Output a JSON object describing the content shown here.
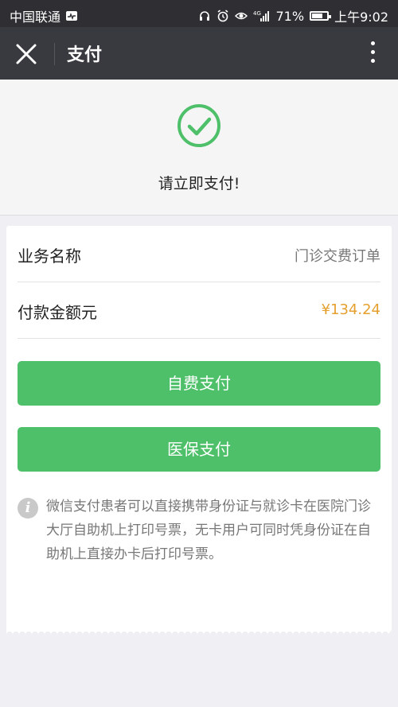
{
  "status_bar": {
    "carrier": "中国联通",
    "battery": "71%",
    "time": "上午9:02"
  },
  "nav": {
    "title": "支付"
  },
  "hero": {
    "message": "请立即支付!"
  },
  "order": {
    "business_label": "业务名称",
    "business_value": "门诊交费订单",
    "amount_label": "付款金额元",
    "amount_value": "¥134.24"
  },
  "buttons": {
    "self_pay": "自费支付",
    "insurance_pay": "医保支付"
  },
  "note": {
    "text": "微信支付患者可以直接携带身份证与就诊卡在医院门诊大厅自助机上打印号票，无卡用户可同时凭身份证在自助机上直接办卡后打印号票。"
  },
  "colors": {
    "accent_green": "#4fc06a",
    "amount_orange": "#e5a02e",
    "navbar": "#393a3f"
  }
}
